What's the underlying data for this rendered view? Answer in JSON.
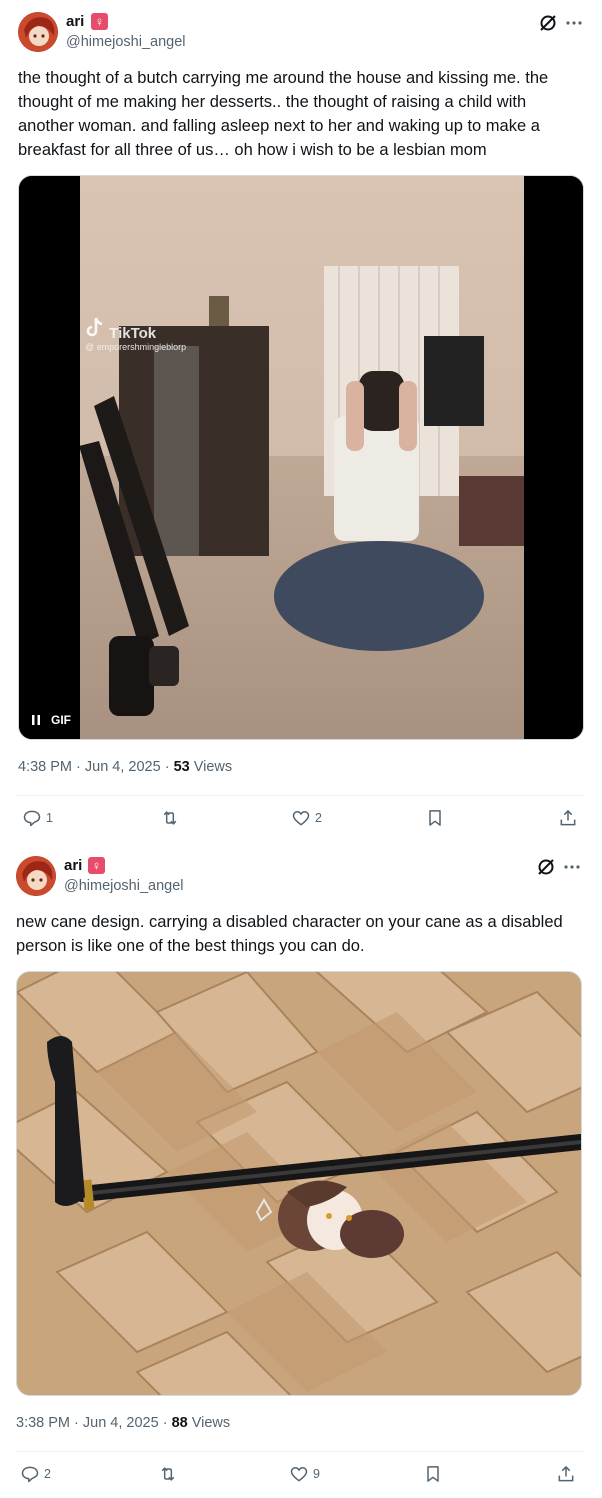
{
  "tweets": [
    {
      "name": "ari",
      "name_emoji": "♀",
      "handle": "@himejoshi_angel",
      "text": "the thought of a butch carrying me around the house and kissing me. the thought of me making her desserts.. the thought of raising a child with another woman. and falling asleep next to her and waking up to make a breakfast for all three of us… oh how i wish to be a lesbian mom",
      "media_type": "gif",
      "gif_label": "GIF",
      "watermark_title": "TikTok",
      "watermark_handle": "@ emporershmingleblorp",
      "time": "4:38 PM · Jun 4, 2025 · ",
      "views_count": "53",
      "views_label": " Views",
      "replies": "1",
      "retweets": "",
      "likes": "2"
    },
    {
      "name": "ari",
      "name_emoji": "♀",
      "handle": "@himejoshi_angel",
      "text": "new cane design. carrying a disabled character on your cane as a disabled person is like one of the best things you can do.",
      "media_type": "photo",
      "time": "3:38 PM · Jun 4, 2025 · ",
      "views_count": "88",
      "views_label": " Views",
      "replies": "2",
      "retweets": "",
      "likes": "9"
    }
  ],
  "icons": {
    "grok": "grok-icon",
    "more": "more-icon",
    "reply": "reply-icon",
    "retweet": "retweet-icon",
    "like": "heart-icon",
    "bookmark": "bookmark-icon",
    "share": "share-icon",
    "pause": "pause-icon",
    "tiktok": "tiktok-logo"
  },
  "colors": {
    "text": "#0f1419",
    "secondary": "#536471",
    "divider": "#eff3f4",
    "badge": "#e74c6a"
  }
}
